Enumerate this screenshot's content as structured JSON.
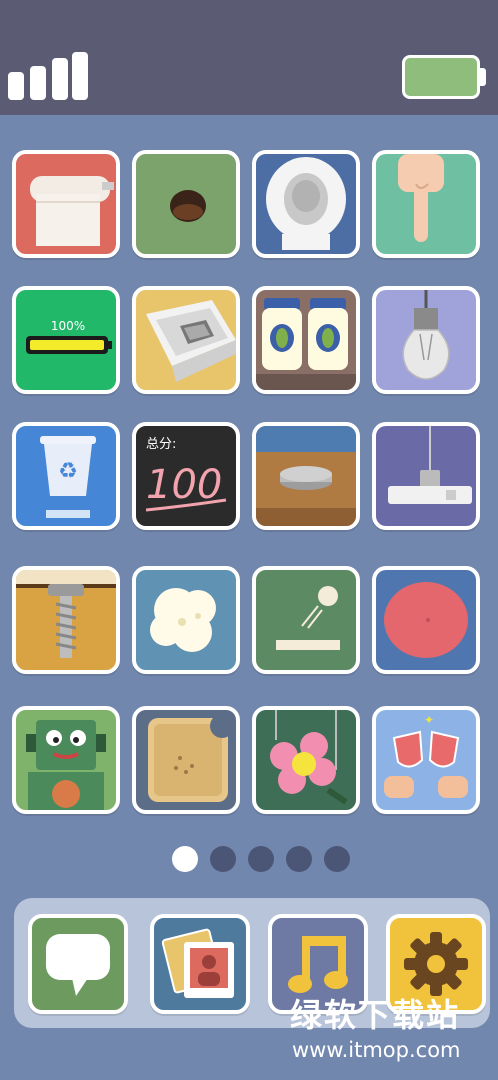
{
  "status_bar": {
    "signal_icon": "signal-bars-icon",
    "battery_icon": "battery-icon",
    "battery_color": "#8fbe7c"
  },
  "apps": [
    {
      "icon": "toilet-paper-icon",
      "bg": "#dc6a5f"
    },
    {
      "icon": "hole-icon",
      "bg": "#7ba36b"
    },
    {
      "icon": "toilet-icon",
      "bg": "#4c6ea5"
    },
    {
      "icon": "pointing-finger-icon",
      "bg": "#6fc0a2"
    },
    {
      "icon": "battery-full-icon",
      "bg": "#22b86a",
      "label": "100%"
    },
    {
      "icon": "phone-in-box-icon",
      "bg": "#e8c46a"
    },
    {
      "icon": "pickle-jars-icon",
      "bg": "#8a6f67"
    },
    {
      "icon": "light-bulb-icon",
      "bg": "#9fa3da"
    },
    {
      "icon": "recycle-bin-icon",
      "bg": "#4587d6"
    },
    {
      "icon": "score-board-icon",
      "bg": "#2b2b2b",
      "label_top": "总分:",
      "label_score": "100"
    },
    {
      "icon": "stone-disc-icon",
      "bg": "#b07a43"
    },
    {
      "icon": "power-plug-icon",
      "bg": "#6a6aa6"
    },
    {
      "icon": "screw-icon",
      "bg": "#d9a243"
    },
    {
      "icon": "popcorn-icon",
      "bg": "#5f92b3"
    },
    {
      "icon": "ball-paddle-icon",
      "bg": "#5c8a63"
    },
    {
      "icon": "pink-ball-icon",
      "bg": "#4f76ae"
    },
    {
      "icon": "robot-icon",
      "bg": "#7fb26a"
    },
    {
      "icon": "toast-icon",
      "bg": "#5b6d87"
    },
    {
      "icon": "flower-icon",
      "bg": "#3f6e57"
    },
    {
      "icon": "wine-toast-icon",
      "bg": "#8db2e6"
    }
  ],
  "page_dots": {
    "count": 5,
    "active": 0
  },
  "dock": [
    {
      "icon": "chat-bubble-icon",
      "bg": "#6c9a5f"
    },
    {
      "icon": "photos-icon",
      "bg": "#4e7a9e"
    },
    {
      "icon": "music-note-icon",
      "bg": "#6e7aa3"
    },
    {
      "icon": "settings-gear-icon",
      "bg": "#f1c23c"
    }
  ],
  "watermark": {
    "title": "绿软下载站",
    "url": "www.itmop.com"
  }
}
